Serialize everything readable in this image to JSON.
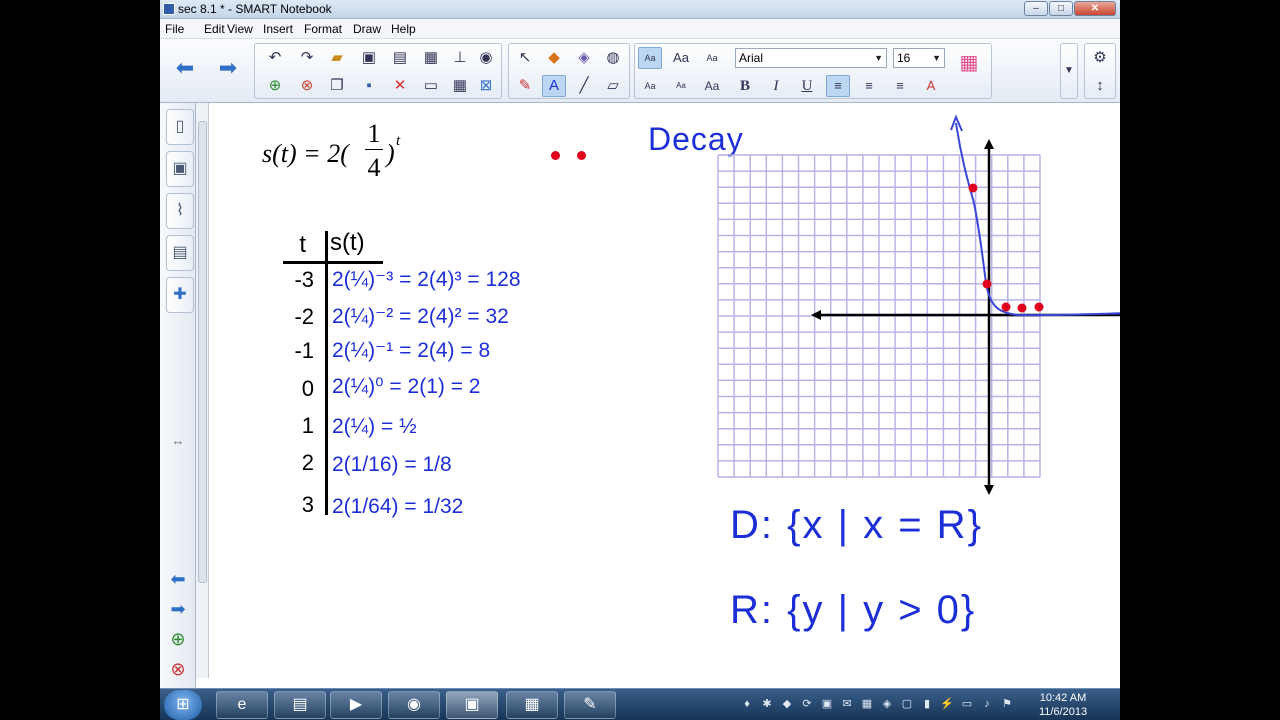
{
  "window": {
    "title": "sec 8.1 * - SMART Notebook",
    "minimize": "–",
    "maximize": "□",
    "close": "✕"
  },
  "menu": [
    "File",
    "Edit",
    "View",
    "Insert",
    "Format",
    "Draw",
    "Help"
  ],
  "toolbar": {
    "font_name": "Arial",
    "font_size": "16",
    "text_style_samples": [
      "Aa",
      "Aa",
      "Aa",
      "Aa",
      "Aa",
      "Aa"
    ],
    "bold": "B",
    "italic": "I",
    "underline": "U"
  },
  "page": {
    "formula": {
      "lhs": "s(t) = 2(",
      "num": "1",
      "den": "4",
      "rhs": ")",
      "exp": "t"
    },
    "table": {
      "col_t": "t",
      "col_s": "s(t)",
      "t_values": [
        "-3",
        "-2",
        "-1",
        "0",
        "1",
        "2",
        "3"
      ],
      "work": [
        "2(¼)⁻³ = 2(4)³ = 128",
        "2(¼)⁻² = 2(4)² = 32",
        "2(¼)⁻¹ = 2(4) = 8",
        "2(¼)⁰ = 2(1) = 2",
        "2(¼) = ½",
        "2(1/16) = 1/8",
        "2(1/64) = 1/32"
      ]
    },
    "graph_label": "Decay",
    "domain": "D: {x | x = R}",
    "range": "R: {y | y > 0}"
  },
  "taskbar": {
    "time": "10:42 AM",
    "date": "11/6/2013"
  },
  "colors": {
    "ink_blue": "#1c2fd6",
    "point_red": "#e0001b",
    "grid_purple": "#b9b2e6"
  }
}
